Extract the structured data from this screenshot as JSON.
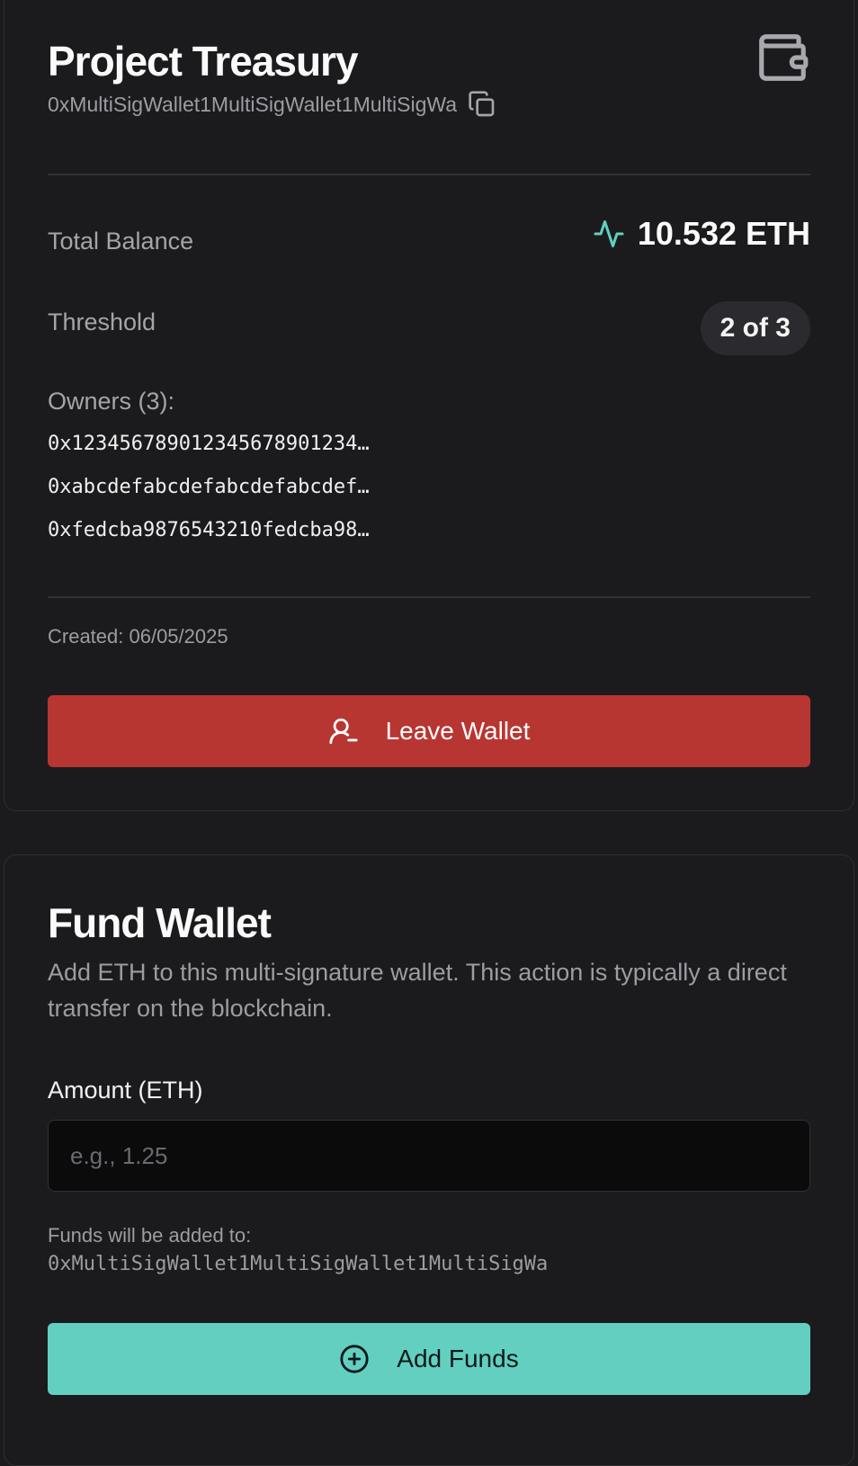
{
  "wallet": {
    "name": "Project Treasury",
    "address": "0xMultiSigWallet1MultiSigWallet1MultiSigWa",
    "balance_label": "Total Balance",
    "balance_value": "10.532 ETH",
    "threshold_label": "Threshold",
    "threshold_value": "2 of 3",
    "owners_label": "Owners (3):",
    "owners": [
      "0x12345678901234567890123​4…",
      "0xabcdefabcdefabcdefabcdef…",
      "0xfedcba9876543210fedcba98…"
    ],
    "created": "Created: 06/05/2025",
    "leave_button": "Leave Wallet",
    "icons": {
      "wallet": "wallet-icon",
      "copy": "copy-icon",
      "balance": "activity-pulse-icon",
      "leave": "user-minus-icon"
    }
  },
  "fund": {
    "title": "Fund Wallet",
    "description": "Add ETH to this multi-signature wallet. This action is typically a direct transfer on the blockchain.",
    "amount_label": "Amount (ETH)",
    "amount_value": "",
    "amount_placeholder": "e.g., 1.25",
    "funds_note": "Funds will be added to:",
    "funds_address": "0xMultiSigWallet1MultiSigWallet1MultiSigWa",
    "add_button": "Add Funds",
    "icons": {
      "add": "plus-circle-icon"
    }
  },
  "colors": {
    "background": "#1b1b1d",
    "accent_teal": "#62cfc1",
    "danger_red": "#b83632"
  }
}
